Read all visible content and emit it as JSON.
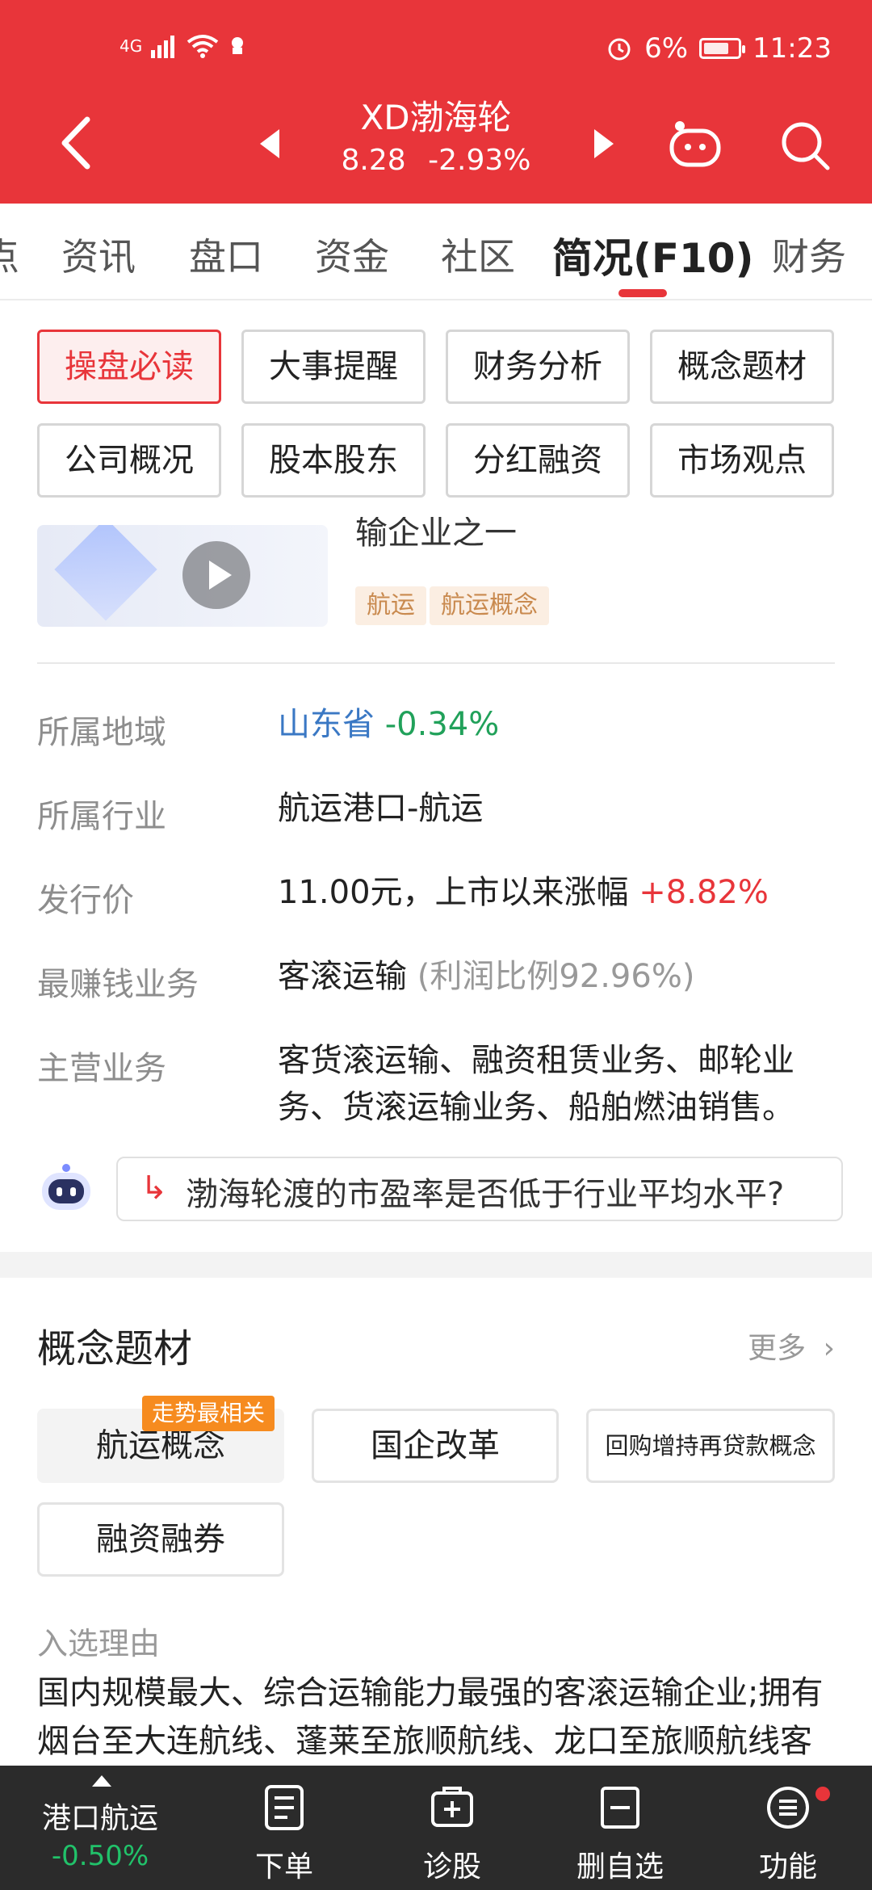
{
  "status_bar": {
    "network": "4G",
    "battery_pct": "6%",
    "time": "11:23"
  },
  "header": {
    "title": "XD渤海轮",
    "price": "8.28",
    "change": "-2.93%"
  },
  "tabs": [
    {
      "label": "点"
    },
    {
      "label": "资讯"
    },
    {
      "label": "盘口"
    },
    {
      "label": "资金"
    },
    {
      "label": "社区"
    },
    {
      "label": "简况(F10)",
      "active": true
    },
    {
      "label": "财务"
    }
  ],
  "subnav": [
    "操盘必读",
    "大事提醒",
    "财务分析",
    "概念题材",
    "公司概况",
    "股本股东",
    "分红融资",
    "市场观点"
  ],
  "video": {
    "cut_text": "输企业之一",
    "tags": [
      "航运",
      "航运概念"
    ]
  },
  "info": {
    "region": {
      "label": "所属地域",
      "value": "山东省",
      "change": "-0.34%"
    },
    "industry": {
      "label": "所属行业",
      "value": "航运港口-航运"
    },
    "ipo": {
      "label": "发行价",
      "value": "11.00元，上市以来涨幅",
      "change": "+8.82%"
    },
    "top_business": {
      "label": "最赚钱业务",
      "value": "客滚运输",
      "ratio": "(利润比例92.96%)"
    },
    "main_business": {
      "label": "主营业务",
      "value": "客货滚运输、融资租赁业务、邮轮业务、货滚运输业务、船舶燃油销售。"
    }
  },
  "ai_question": "渤海轮渡的市盈率是否低于行业平均水平?",
  "concepts": {
    "title": "概念题材",
    "more": "更多",
    "badge": "走势最相关",
    "chips": [
      "航运概念",
      "国企改革",
      "回购增持再贷款概念",
      "融资融券"
    ],
    "reason_label": "入选理由",
    "reason_text": "国内规模最大、综合运输能力最强的客滚运输企业;拥有烟台至大连航线、蓬莱至旅顺航线、龙口至旅顺航线客"
  },
  "bottom_bar": {
    "sector_name": "港口航运",
    "sector_change": "-0.50%",
    "items": [
      "下单",
      "诊股",
      "删自选",
      "功能"
    ]
  },
  "colors": {
    "brand_red": "#e8353a",
    "up": "#e8353a",
    "down": "#21a15a"
  }
}
